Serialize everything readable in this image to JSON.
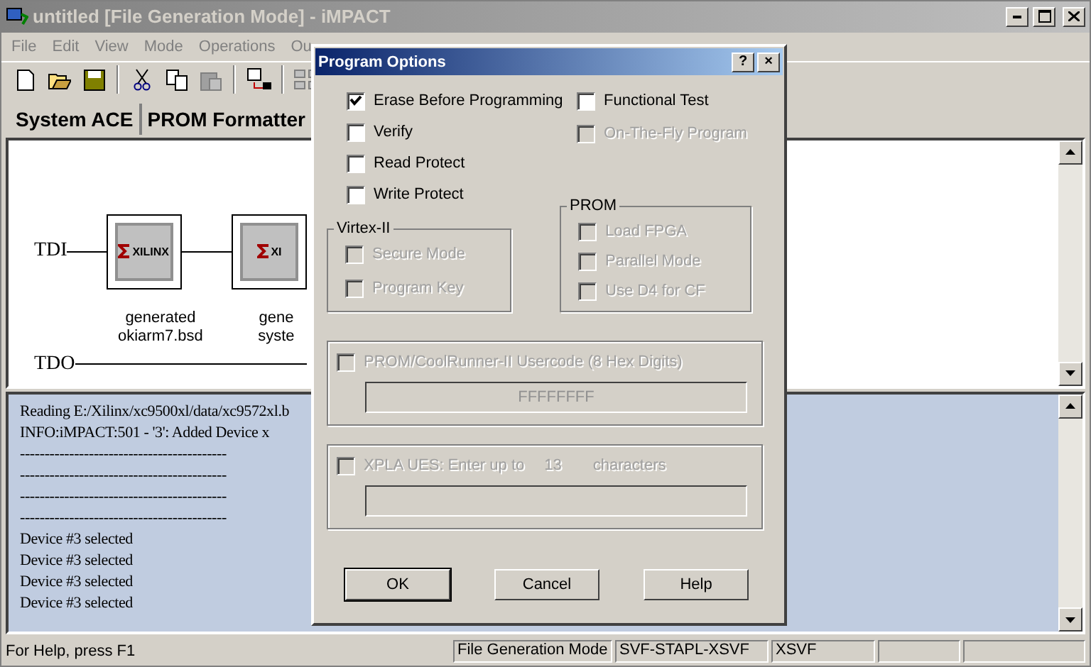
{
  "window": {
    "title": "untitled [File Generation Mode]  - iMPACT"
  },
  "menu": [
    "File",
    "Edit",
    "View",
    "Mode",
    "Operations",
    "Ou"
  ],
  "toolbar": [
    {
      "kind": "new",
      "disabled": false
    },
    {
      "kind": "open",
      "disabled": false
    },
    {
      "kind": "save",
      "disabled": false
    },
    {
      "kind": "sep"
    },
    {
      "kind": "cut",
      "disabled": false
    },
    {
      "kind": "copy",
      "disabled": false
    },
    {
      "kind": "paste",
      "disabled": true
    },
    {
      "kind": "sep"
    },
    {
      "kind": "program",
      "disabled": false
    },
    {
      "kind": "sep"
    },
    {
      "kind": "chain",
      "disabled": true
    }
  ],
  "tabs": [
    "System ACE",
    "PROM Formatter"
  ],
  "chain": {
    "tdi": "TDI",
    "tdo": "TDO",
    "devices": [
      {
        "logo": "XILINX",
        "lines": [
          "generated",
          "okiarm7.bsd"
        ]
      },
      {
        "logo": "XI",
        "lines": [
          "gene",
          "syste"
        ]
      }
    ]
  },
  "log": [
    "Reading E:/Xilinx/xc9500xl/data/xc9572xl.b",
    "INFO:iMPACT:501 - '3': Added Device x",
    "------------------------------------------",
    "------------------------------------------",
    "------------------------------------------",
    "------------------------------------------",
    "Device #3 selected",
    "Device #3 selected",
    "Device #3 selected",
    "Device #3 selected"
  ],
  "status_bar": {
    "help": "For Help, press F1",
    "panes": [
      "File Generation Mode",
      "SVF-STAPL-XSVF",
      "XSVF"
    ]
  },
  "dialog": {
    "title": "Program Options",
    "title_buttons": [
      "?",
      "×"
    ],
    "left_options": [
      {
        "label": "Erase Before Programming",
        "checked": true,
        "disabled": false
      },
      {
        "label": "Verify",
        "checked": false,
        "disabled": false
      },
      {
        "label": "Read Protect",
        "checked": false,
        "disabled": false
      },
      {
        "label": "Write Protect",
        "checked": false,
        "disabled": false
      }
    ],
    "right_options": [
      {
        "label": "Functional Test",
        "checked": false,
        "disabled": false
      },
      {
        "label": "On-The-Fly Program",
        "checked": false,
        "disabled": true
      }
    ],
    "virtex": {
      "title": "Virtex-II",
      "options": [
        {
          "label": "Secure Mode",
          "checked": false,
          "disabled": true
        },
        {
          "label": "Program Key",
          "checked": false,
          "disabled": true
        }
      ]
    },
    "prom": {
      "title": "PROM",
      "options": [
        {
          "label": "Load FPGA",
          "checked": false,
          "disabled": true
        },
        {
          "label": "Parallel Mode",
          "checked": false,
          "disabled": true
        },
        {
          "label": "Use D4 for CF",
          "checked": false,
          "disabled": true
        }
      ]
    },
    "usercode": {
      "label": "PROM/CoolRunner-II Usercode (8 Hex Digits)",
      "checked": false,
      "disabled": true,
      "value": "FFFFFFFF"
    },
    "xpla": {
      "label": "XPLA UES: Enter up to",
      "count": "13",
      "suffix": "characters",
      "checked": false,
      "disabled": true
    },
    "buttons": [
      "OK",
      "Cancel",
      "Help"
    ]
  }
}
